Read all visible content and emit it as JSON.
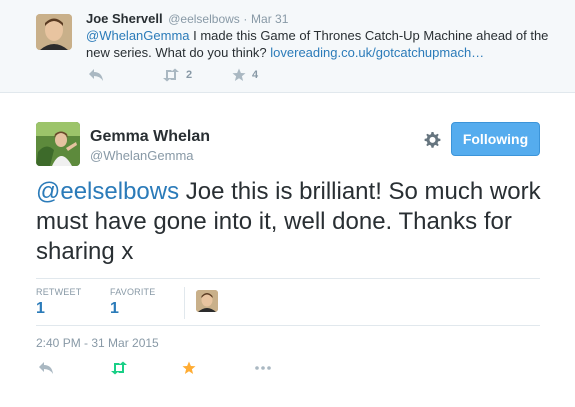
{
  "parent_tweet": {
    "name": "Joe Shervell",
    "handle": "@eelselbows",
    "separator": "·",
    "date": "Mar 31",
    "mention": "@WhelanGemma",
    "text": " I made this Game of Thrones Catch-Up Machine ahead of the new series. What do you think? ",
    "link": "lovereading.co.uk/gotcatchupmach…",
    "retweet_count": "2",
    "favorite_count": "4"
  },
  "main_tweet": {
    "name": "Gemma Whelan",
    "handle": "@WhelanGemma",
    "follow_label": "Following",
    "mention": "@eelselbows",
    "text": " Joe this is brilliant! So much work must have gone into it, well done. Thanks for sharing x",
    "retweets_label": "RETWEET",
    "retweets_value": "1",
    "favorites_label": "FAVORITE",
    "favorites_value": "1",
    "timestamp": "2:40 PM - 31 Mar 2015"
  },
  "icons": {
    "reply": "reply-icon",
    "retweet": "retweet-icon",
    "favorite": "star-icon",
    "more": "more-icon",
    "settings": "gear-icon"
  },
  "colors": {
    "accent": "#55acee",
    "link": "#2b7bb9",
    "retweet_active": "#19cf86",
    "favorite_active": "#ffac33",
    "muted": "#8899a6",
    "parent_bg": "#f5f8fa"
  }
}
